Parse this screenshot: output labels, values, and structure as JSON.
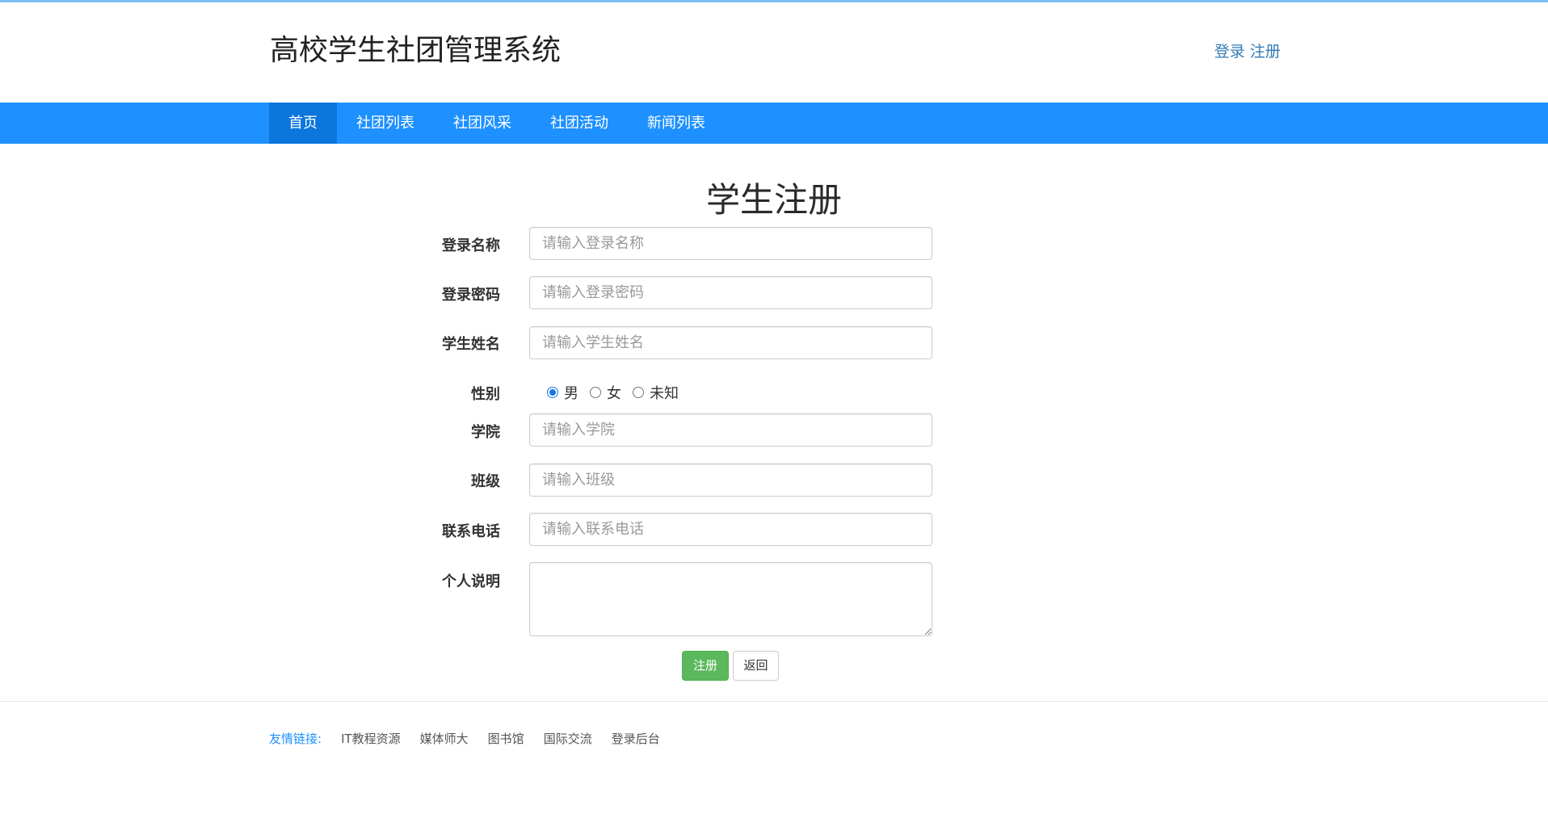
{
  "header": {
    "site_title": "高校学生社团管理系统",
    "login_link": "登录",
    "register_link": "注册"
  },
  "nav": {
    "items": [
      {
        "label": "首页",
        "active": true
      },
      {
        "label": "社团列表",
        "active": false
      },
      {
        "label": "社团风采",
        "active": false
      },
      {
        "label": "社团活动",
        "active": false
      },
      {
        "label": "新闻列表",
        "active": false
      }
    ]
  },
  "form": {
    "title": "学生注册",
    "login_name": {
      "label": "登录名称",
      "placeholder": "请输入登录名称",
      "value": ""
    },
    "password": {
      "label": "登录密码",
      "placeholder": "请输入登录密码",
      "value": ""
    },
    "student_name": {
      "label": "学生姓名",
      "placeholder": "请输入学生姓名",
      "value": ""
    },
    "gender": {
      "label": "性别",
      "options": [
        "男",
        "女",
        "未知"
      ],
      "selected": "男"
    },
    "college": {
      "label": "学院",
      "placeholder": "请输入学院",
      "value": ""
    },
    "class_name": {
      "label": "班级",
      "placeholder": "请输入班级",
      "value": ""
    },
    "phone": {
      "label": "联系电话",
      "placeholder": "请输入联系电话",
      "value": ""
    },
    "description": {
      "label": "个人说明",
      "value": ""
    },
    "submit_label": "注册",
    "back_label": "返回"
  },
  "footer": {
    "label": "友情链接:",
    "links": [
      "IT教程资源",
      "媒体师大",
      "图书馆",
      "国际交流",
      "登录后台"
    ]
  },
  "colors": {
    "nav_bg": "#1e90ff",
    "nav_active_bg": "#0d76dc",
    "link": "#337ab7",
    "success": "#5cb85c",
    "footer_label": "#1e90ff"
  }
}
